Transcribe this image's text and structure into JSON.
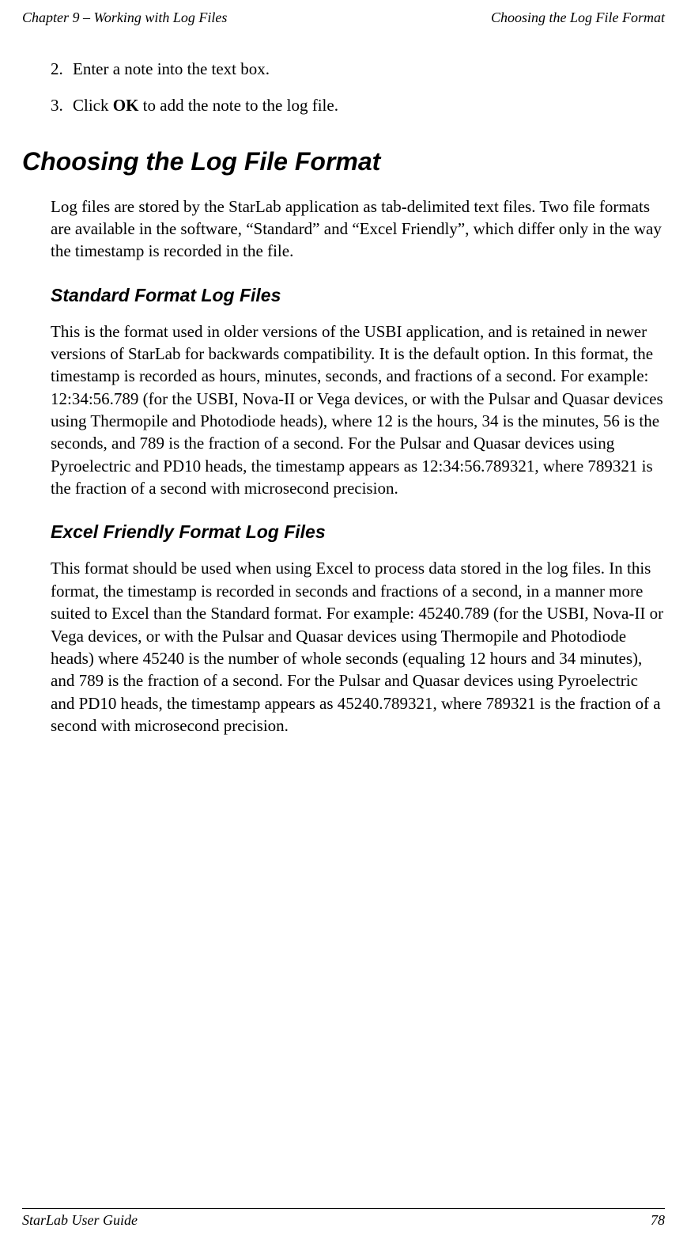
{
  "header": {
    "left": "Chapter 9 – Working with Log Files",
    "right": "Choosing the Log File Format"
  },
  "steps": [
    {
      "num": "2.",
      "text": "Enter a note into the text box."
    },
    {
      "num": "3.",
      "prefix": "Click ",
      "bold": "OK",
      "suffix": " to add the note to the log file."
    }
  ],
  "heading1": "Choosing the Log File Format",
  "intro_para": "Log files are stored by the StarLab application as tab-delimited text files. Two file formats are available in the software, “Standard” and “Excel Friendly”, which differ only in the way the timestamp is recorded in the file.",
  "section1": {
    "title": "Standard Format Log Files",
    "body": "This is the format used in older versions of the USBI application, and is retained in newer versions of StarLab for backwards compatibility. It is the default option. In this format, the timestamp is recorded as hours, minutes, seconds, and fractions of a second. For example: 12:34:56.789 (for the USBI, Nova-II or Vega devices, or with the Pulsar and Quasar devices using Thermopile and Photodiode heads), where 12 is the hours, 34 is the minutes, 56 is the seconds, and 789 is the fraction of a second. For the Pulsar and Quasar devices using Pyroelectric and PD10 heads, the timestamp appears as 12:34:56.789321, where 789321 is the fraction of a second with microsecond precision."
  },
  "section2": {
    "title": "Excel Friendly Format Log Files",
    "body": "This format should be used when using Excel to process data stored in the log files. In this format, the timestamp is recorded in seconds and fractions of a second, in a manner more suited to Excel than the Standard format. For example: 45240.789 (for the USBI, Nova-II or Vega devices, or with the Pulsar and Quasar devices using Thermopile and Photodiode heads) where 45240 is the number of whole seconds (equaling 12 hours and 34 minutes), and 789 is the fraction of a second. For the Pulsar and Quasar devices using Pyroelectric and PD10 heads, the timestamp appears as 45240.789321, where 789321 is the fraction of a second with microsecond precision."
  },
  "footer": {
    "left": "StarLab User Guide",
    "right": "78"
  }
}
